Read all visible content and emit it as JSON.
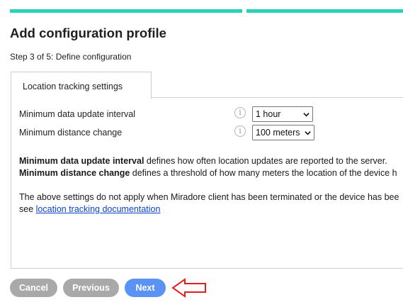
{
  "page": {
    "title": "Add configuration profile",
    "step": "Step 3 of 5: Define configuration"
  },
  "progress": {
    "segments_total": 2,
    "segments_visible_complete": 2,
    "color": "#2bd0b8"
  },
  "tabs": [
    {
      "label": "Location tracking settings",
      "active": true
    }
  ],
  "settings": [
    {
      "label": "Minimum data update interval",
      "value": "1 hour",
      "info_icon": "info-icon"
    },
    {
      "label": "Minimum distance change",
      "value": "100 meters",
      "info_icon": "info-icon"
    }
  ],
  "description": {
    "line1_bold": "Minimum data update interval",
    "line1_rest": " defines how often location updates are reported to the server.",
    "line2_bold": "Minimum distance change",
    "line2_rest": " defines a threshold of how many meters the location of the device h",
    "line3": "The above settings do not apply when Miradore client has been terminated or the device has bee",
    "line4_prefix": "see ",
    "line4_link": "location tracking documentation"
  },
  "buttons": {
    "cancel": "Cancel",
    "previous": "Previous",
    "next": "Next"
  },
  "colors": {
    "next_button": "#5b93f5",
    "disabled_button": "#a9a9a9",
    "annotation_arrow": "#e02020"
  },
  "annotation": {
    "icon": "red-arrow-icon",
    "points_to": "next-button"
  }
}
